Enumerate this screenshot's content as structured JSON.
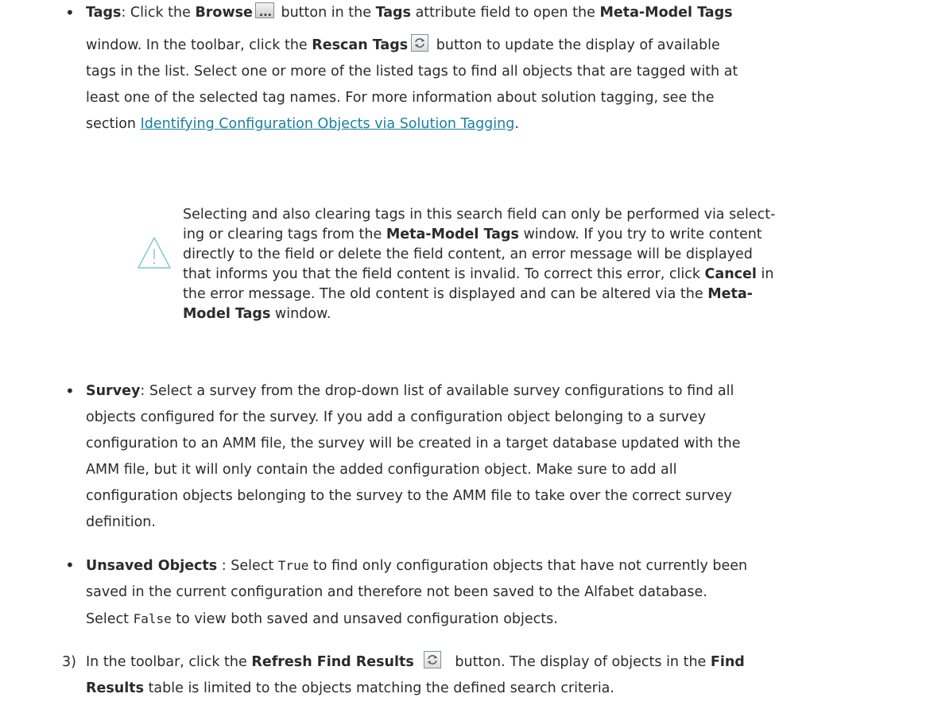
{
  "tags": {
    "label": "Tags",
    "t1": ": Click the ",
    "browse": "Browse",
    "t2": " button in the ",
    "tags_word": "Tags",
    "t3": " attribute field to open the ",
    "window_name": "Meta-Model Tags",
    "t4": "window. In the toolbar, click the ",
    "rescan": "Rescan Tags",
    "t5": " button to update the display of available",
    "line3": "tags in the list. Select one or more of the listed tags to find all objects that are tagged with at",
    "line4": "least one of the selected tag names. For more information about solution tagging, see the",
    "t6": "section ",
    "link": "Identifying Configuration Objects via Solution Tagging",
    "t7": "."
  },
  "note": {
    "n1": "Selecting and also clearing tags in this search field can only be performed via select-",
    "n2a": "ing or clearing tags from the ",
    "n2b": "Meta-Model Tags",
    "n2c": " window. If you try to write content",
    "n3": "directly to the field or delete the field content, an error message will be displayed",
    "n4": "that informs you that the field content is invalid. To correct this error, click ",
    "n4b": "Cancel",
    "n4c": " in",
    "n5a": "the error message. The old content is displayed and can be altered via the ",
    "n5b": "Meta-",
    "n6a": "Model Tags",
    "n6b": " window."
  },
  "survey": {
    "label": "Survey",
    "l1": ": Select a survey from the drop-down list of available survey configurations to find all",
    "l2": "objects configured for the survey. If you add a configuration object belonging to a survey",
    "l3": "configuration to an AMM file, the survey will be created in a target database updated with the",
    "l4": "AMM file, but it will only contain the added configuration object. Make sure to add all",
    "l5": "configuration objects belonging to the survey to the AMM file to take over the correct survey",
    "l6": "definition."
  },
  "unsaved": {
    "label": "Unsaved Objects",
    "l1a": " : Select ",
    "true_val": "True",
    "l1b": " to find only configuration objects that have not currently been",
    "l2": "saved in the current configuration and therefore not been saved to the Alfabet database.",
    "l3a": "Select ",
    "false_val": "False",
    "l3b": " to view both saved and unsaved configuration objects."
  },
  "step3": {
    "num": "3)",
    "a": "In the toolbar, click the ",
    "refresh": "Refresh Find Results",
    "b": " button. The display of objects in the ",
    "find": "Find",
    "results": "Results",
    "c": " table is limited to the objects matching the defined search criteria."
  },
  "bullet_char": "•"
}
